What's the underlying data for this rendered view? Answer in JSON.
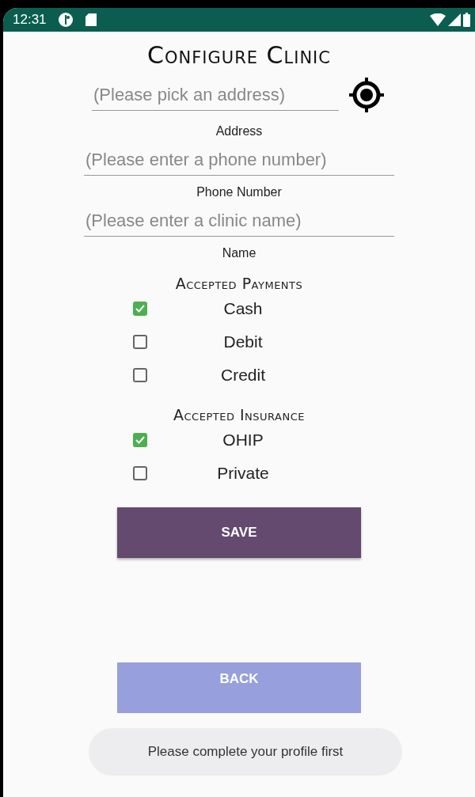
{
  "status_bar": {
    "time": "12:31"
  },
  "title": "Configure Clinic",
  "fields": [
    {
      "placeholder": "(Please pick an address)",
      "label": "Address",
      "kind": "location"
    },
    {
      "placeholder": "(Please enter a phone number)",
      "label": "Phone Number",
      "kind": "text"
    },
    {
      "placeholder": "(Please enter a clinic name)",
      "label": "Name",
      "kind": "text"
    }
  ],
  "groups": [
    {
      "heading": "Accepted Payments",
      "options": [
        {
          "label": "Cash",
          "checked": true
        },
        {
          "label": "Debit",
          "checked": false
        },
        {
          "label": "Credit",
          "checked": false
        }
      ]
    },
    {
      "heading": "Accepted Insurance",
      "options": [
        {
          "label": "OHIP",
          "checked": true
        },
        {
          "label": "Private",
          "checked": false
        }
      ]
    }
  ],
  "save_button": "SAVE",
  "back_button": "BACK",
  "toast": "Please complete your profile first"
}
